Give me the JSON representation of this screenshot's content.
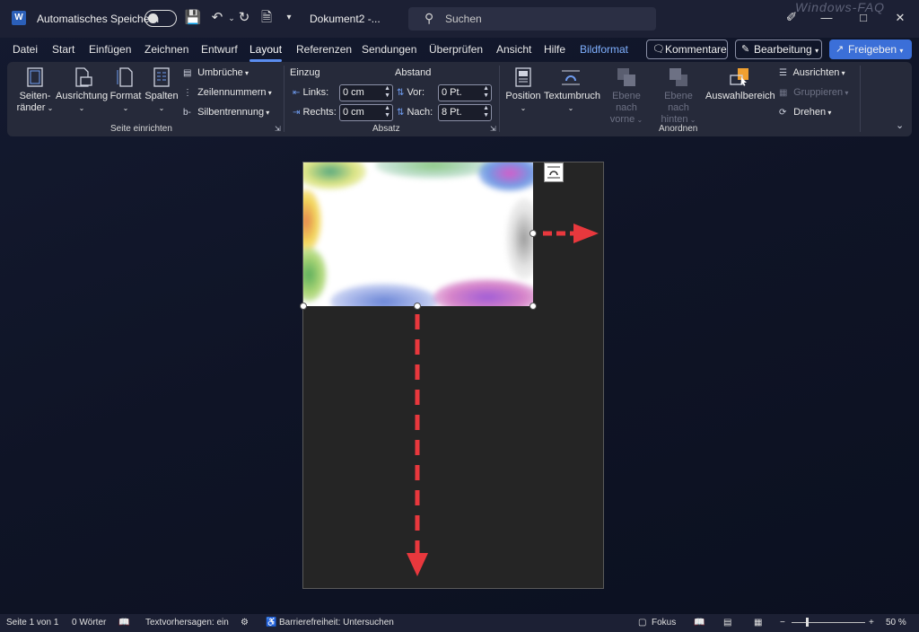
{
  "titlebar": {
    "app_icon": "word-logo",
    "autosave_label": "Automatisches Speichern",
    "document_title": "Dokument2  -...",
    "search_placeholder": "Suchen",
    "watermark": "Windows-FAQ"
  },
  "menu": {
    "tabs": [
      "Datei",
      "Start",
      "Einfügen",
      "Zeichnen",
      "Entwurf",
      "Layout",
      "Referenzen",
      "Sendungen",
      "Überprüfen",
      "Ansicht",
      "Hilfe",
      "Bildformat"
    ],
    "active_tab": "Layout",
    "comments_button": "Kommentare",
    "editing_button": "Bearbeitung",
    "share_button": "Freigeben"
  },
  "ribbon": {
    "page_setup": {
      "margins": "Seiten-\nränder",
      "margins_l1": "Seiten-",
      "margins_l2": "ränder",
      "orientation": "Ausrichtung",
      "size": "Format",
      "columns": "Spalten",
      "breaks": "Umbrüche",
      "line_numbers": "Zeilennummern",
      "hyphenation": "Silbentrennung",
      "group_label": "Seite einrichten"
    },
    "paragraph": {
      "indent_label": "Einzug",
      "spacing_label": "Abstand",
      "left_label": "Links:",
      "left_value": "0 cm",
      "right_label": "Rechts:",
      "right_value": "0 cm",
      "before_label": "Vor:",
      "before_value": "0 Pt.",
      "after_label": "Nach:",
      "after_value": "8 Pt.",
      "group_label": "Absatz"
    },
    "arrange": {
      "position": "Position",
      "wrap_text": "Textumbruch",
      "bring_forward_l1": "Ebene nach",
      "bring_forward_l2": "vorne",
      "send_backward_l1": "Ebene nach",
      "send_backward_l2": "hinten",
      "selection_pane": "Auswahlbereich",
      "align": "Ausrichten",
      "group": "Gruppieren",
      "rotate": "Drehen",
      "group_label": "Anordnen"
    }
  },
  "statusbar": {
    "page": "Seite 1 von 1",
    "words": "0 Wörter",
    "text_predictions": "Textvorhersagen: ein",
    "accessibility": "Barrierefreiheit: Untersuchen",
    "focus": "Fokus",
    "zoom_minus": "−",
    "zoom_plus": "+",
    "zoom": "50 %",
    "zoom_fraction": 0.2
  },
  "colors": {
    "accent_blue": "#3b6fd8",
    "arrow_red": "#e8383d"
  }
}
